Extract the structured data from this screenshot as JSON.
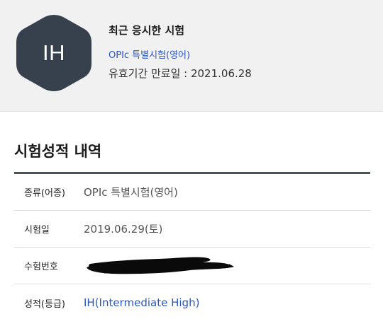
{
  "recent_exam": {
    "badge": "IH",
    "badge_color": "#37414d",
    "title": "최근 응시한 시험",
    "exam_name": "OPIc 특별시험(영어)",
    "expiry": "유효기간 만료일 : 2021.06.28"
  },
  "history": {
    "title": "시험성적 내역",
    "rows": [
      {
        "label": "종류(어종)",
        "value": "OPIc 특별시험(영어)"
      },
      {
        "label": "시험일",
        "value": "2019.06.29(토)"
      },
      {
        "label": "수험번호",
        "value": ""
      },
      {
        "label": "성적(등급)",
        "value": "IH(Intermediate High)"
      }
    ]
  },
  "colors": {
    "link_blue": "#2c55c4",
    "card_bg": "#f1f1f1",
    "table_rule": "#4a525d"
  }
}
